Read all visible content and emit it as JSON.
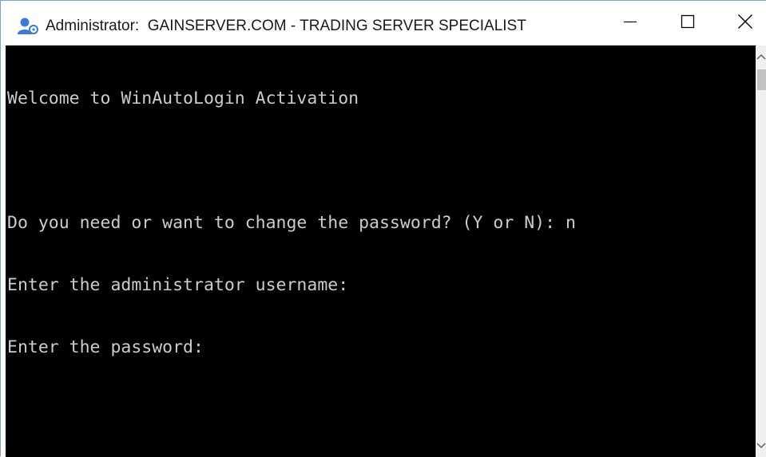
{
  "window": {
    "title": "Administrator:  GAINSERVER.COM - TRADING SERVER SPECIALIST",
    "icon": "user-settings-icon",
    "controls": {
      "minimize_icon": "minimize-icon",
      "maximize_icon": "maximize-icon",
      "close_icon": "close-icon"
    }
  },
  "console": {
    "lines": [
      "Welcome to WinAutoLogin Activation",
      "",
      "Do you need or want to change the password? (Y or N): n",
      "Enter the administrator username:",
      "Enter the password:"
    ]
  },
  "scrollbar": {
    "up_icon": "chevron-up-icon",
    "down_icon": "chevron-down-icon"
  },
  "colors": {
    "console_background": "#000000",
    "console_text": "#cccccc",
    "titlebar_background": "#ffffff",
    "icon_accent": "#3a7bd5"
  }
}
